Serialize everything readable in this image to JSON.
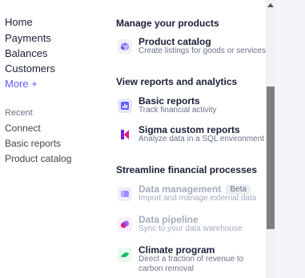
{
  "sidebar": {
    "items": [
      {
        "label": "Home"
      },
      {
        "label": "Payments"
      },
      {
        "label": "Balances"
      },
      {
        "label": "Customers"
      },
      {
        "label": "More +"
      }
    ],
    "recent_title": "Recent",
    "recent_items": [
      {
        "label": "Connect"
      },
      {
        "label": "Basic reports"
      },
      {
        "label": "Product catalog"
      }
    ]
  },
  "main": {
    "sections": [
      {
        "title": "Manage your products",
        "items": [
          {
            "title": "Product catalog",
            "desc": "Create listings for goods or services",
            "icon": "box-icon",
            "color": "#8d7ffa"
          }
        ]
      },
      {
        "title": "View reports and analytics",
        "items": [
          {
            "title": "Basic reports",
            "desc": "Track financial activity",
            "icon": "bar-chart-icon",
            "color": "#635bff"
          },
          {
            "title": "Sigma custom reports",
            "desc": "Analyze data in a SQL environment",
            "icon": "sigma-logo-icon",
            "color": "#e0187a"
          }
        ]
      },
      {
        "title": "Streamline financial processes",
        "items": [
          {
            "title": "Data management",
            "badge": "Beta",
            "desc": "Import and manage external data",
            "icon": "database-icon",
            "color": "#9b8cff"
          },
          {
            "title": "Data pipeline",
            "desc": "Sync to your data warehouse",
            "icon": "pipeline-icon",
            "color": "#c44ce0"
          },
          {
            "title": "Climate program",
            "desc": "Direct a fraction of revenue to carbon removal",
            "icon": "leaf-icon",
            "color": "#1ec46a"
          }
        ]
      }
    ]
  }
}
